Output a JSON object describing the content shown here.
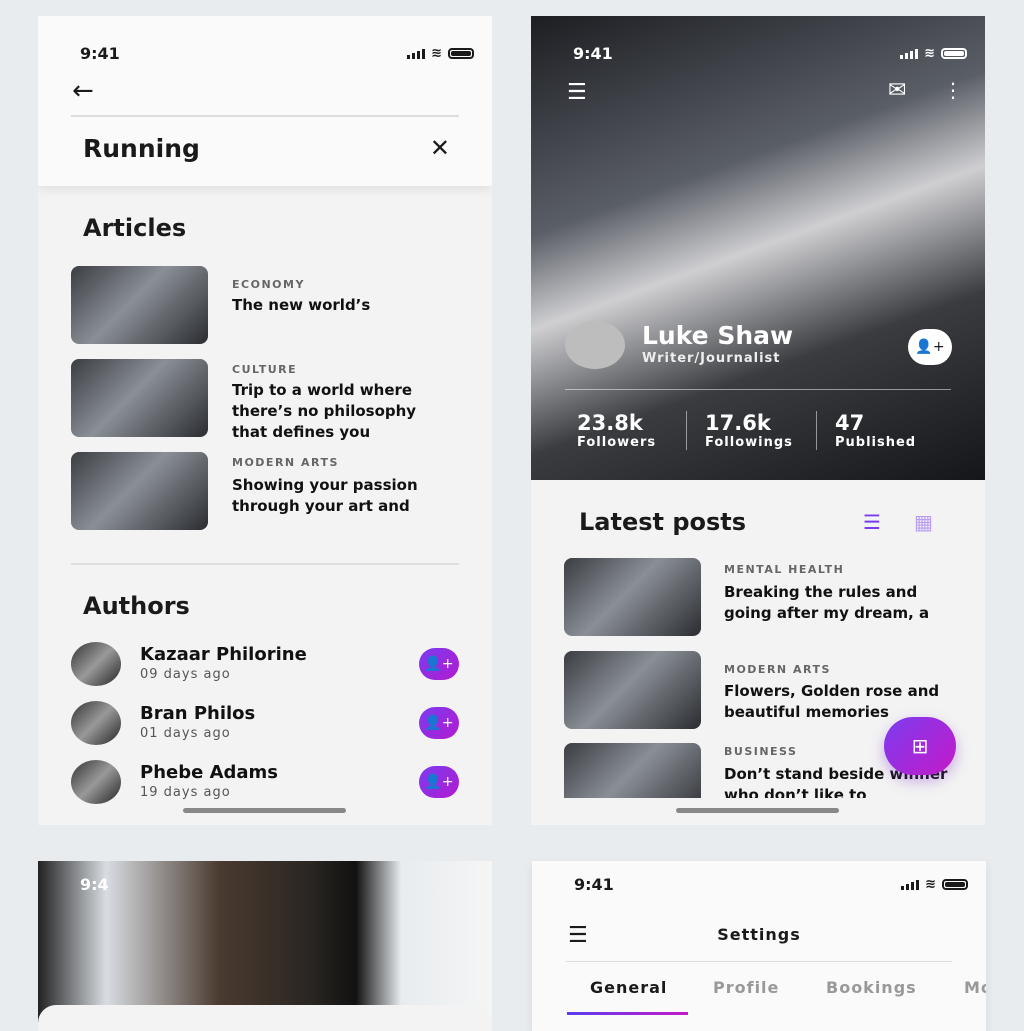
{
  "status_time": "9:41",
  "search": {
    "query": "Running",
    "articles_heading": "Articles",
    "authors_heading": "Authors",
    "articles": [
      {
        "category": "ECONOMY",
        "title": "The new world’s"
      },
      {
        "category": "CULTURE",
        "title": "Trip to a world where there’s no philosophy that defines you"
      },
      {
        "category": "MODERN ARTS",
        "title": "Showing your passion through your art and"
      }
    ],
    "authors": [
      {
        "name": "Kazaar Philorine",
        "time": "09 days ago"
      },
      {
        "name": "Bran Philos",
        "time": "01 days ago"
      },
      {
        "name": "Phebe Adams",
        "time": "19 days ago"
      }
    ]
  },
  "profile": {
    "name": "Luke Shaw",
    "role": "Writer/Journalist",
    "stats": [
      {
        "value": "23.8k",
        "label": "Followers"
      },
      {
        "value": "17.6k",
        "label": "Followings"
      },
      {
        "value": "47",
        "label": "Published"
      }
    ],
    "latest_heading": "Latest posts",
    "posts": [
      {
        "category": "MENTAL HEALTH",
        "title": "Breaking the rules and going after my dream, a"
      },
      {
        "category": "MODERN ARTS",
        "title": "Flowers, Golden rose and beautiful memories"
      },
      {
        "category": "BUSINESS",
        "title": "Don’t stand beside winner who don’t like to"
      }
    ]
  },
  "settings": {
    "title": "Settings",
    "tabs": [
      "General",
      "Profile",
      "Bookings",
      "Mo"
    ]
  },
  "partial_status_time": "9:4",
  "colors": {
    "accent_start": "#5b3cf0",
    "accent_end": "#c41ac8"
  }
}
